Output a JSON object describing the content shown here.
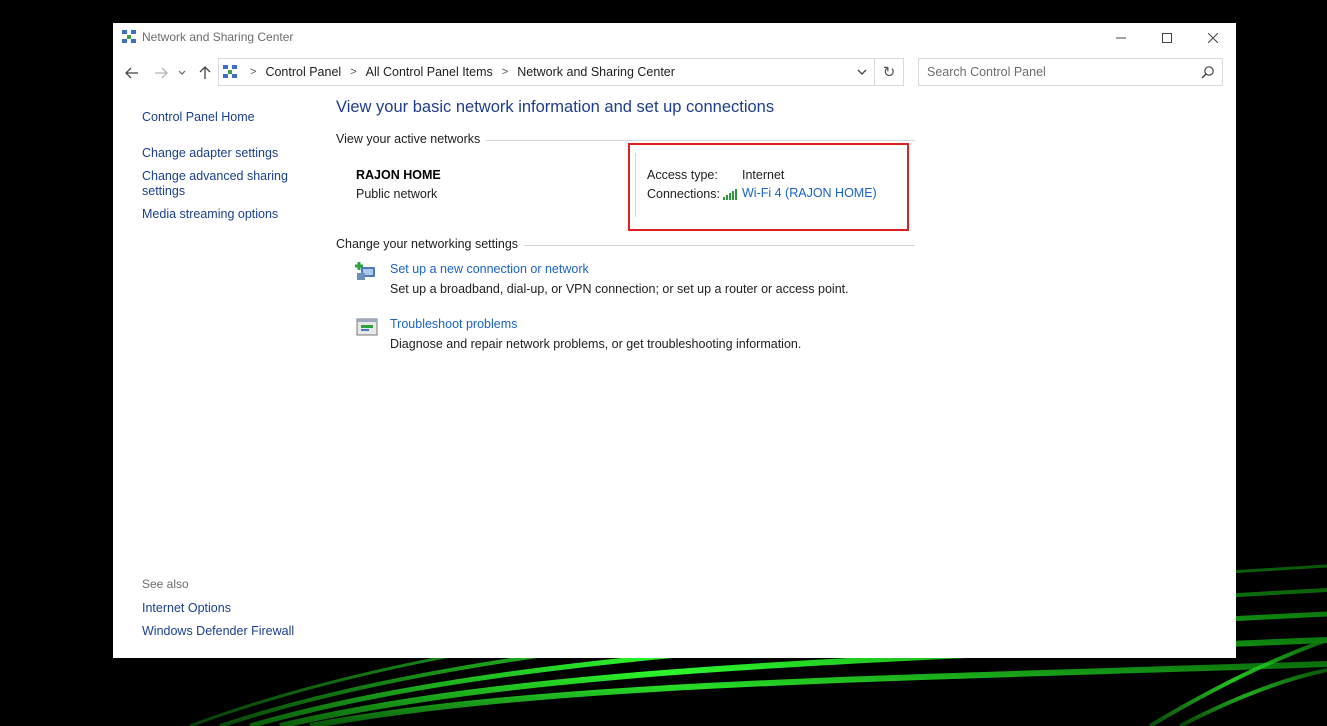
{
  "window": {
    "title": "Network and Sharing Center"
  },
  "address_bar": {
    "crumbs": [
      "Control Panel",
      "All Control Panel Items",
      "Network and Sharing Center"
    ]
  },
  "search": {
    "placeholder": "Search Control Panel"
  },
  "sidebar": {
    "home": "Control Panel Home",
    "links": [
      "Change adapter settings",
      "Change advanced sharing settings",
      "Media streaming options"
    ],
    "see_also_label": "See also",
    "see_also": [
      "Internet Options",
      "Windows Defender Firewall"
    ]
  },
  "main": {
    "title": "View your basic network information and set up connections",
    "active_networks_heading": "View your active networks",
    "network": {
      "name": "RAJON HOME",
      "type": "Public network",
      "access_type_label": "Access type:",
      "access_type_value": "Internet",
      "connections_label": "Connections:",
      "connection_name": "Wi-Fi 4 (RAJON HOME)"
    },
    "settings_heading": "Change your networking settings",
    "tasks": [
      {
        "link": "Set up a new connection or network",
        "description": "Set up a broadband, dial-up, or VPN connection; or set up a router or access point."
      },
      {
        "link": "Troubleshoot problems",
        "description": "Diagnose and repair network problems, or get troubleshooting information."
      }
    ]
  },
  "colors": {
    "link": "#1a63c8",
    "title": "#1e3d8f",
    "highlight_box": "#e02020",
    "wallpaper_glow": "#22ee22"
  }
}
